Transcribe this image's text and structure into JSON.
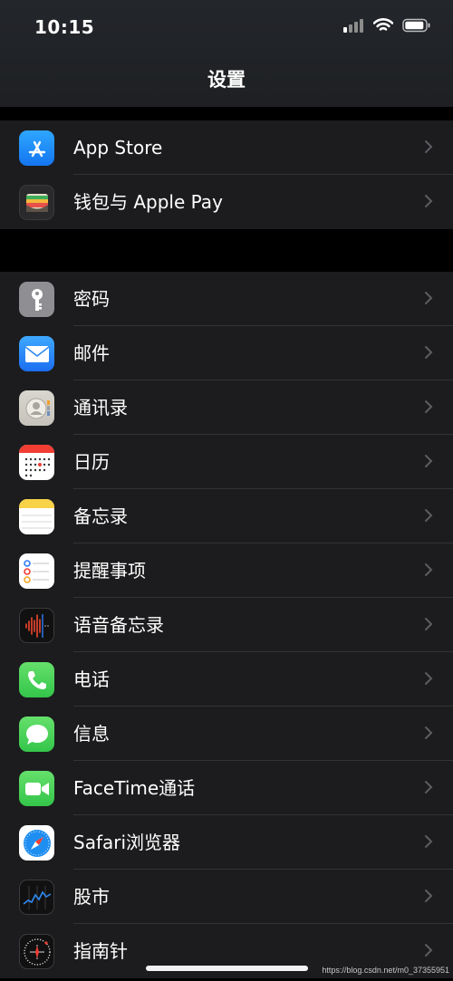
{
  "status_bar": {
    "time": "10:15"
  },
  "header": {
    "title": "设置"
  },
  "groups": [
    {
      "items": [
        {
          "label": "App Store",
          "icon": "app-store-icon"
        },
        {
          "label": "钱包与 Apple Pay",
          "icon": "wallet-icon"
        }
      ]
    },
    {
      "items": [
        {
          "label": "密码",
          "icon": "key-icon"
        },
        {
          "label": "邮件",
          "icon": "mail-icon"
        },
        {
          "label": "通讯录",
          "icon": "contacts-icon"
        },
        {
          "label": "日历",
          "icon": "calendar-icon"
        },
        {
          "label": "备忘录",
          "icon": "notes-icon"
        },
        {
          "label": "提醒事项",
          "icon": "reminders-icon"
        },
        {
          "label": "语音备忘录",
          "icon": "voice-memos-icon"
        },
        {
          "label": "电话",
          "icon": "phone-icon"
        },
        {
          "label": "信息",
          "icon": "messages-icon"
        },
        {
          "label": "FaceTime通话",
          "icon": "facetime-icon"
        },
        {
          "label": "Safari浏览器",
          "icon": "safari-icon"
        },
        {
          "label": "股市",
          "icon": "stocks-icon"
        },
        {
          "label": "指南针",
          "icon": "compass-icon"
        }
      ]
    }
  ],
  "watermark": "https://blog.csdn.net/m0_37355951",
  "colors": {
    "app_store": "#1a8cf5",
    "mail": "#2f8bf2",
    "phone": "#4cd964",
    "messages": "#4cd964",
    "facetime": "#4cd964",
    "key": "#8e8e93"
  }
}
